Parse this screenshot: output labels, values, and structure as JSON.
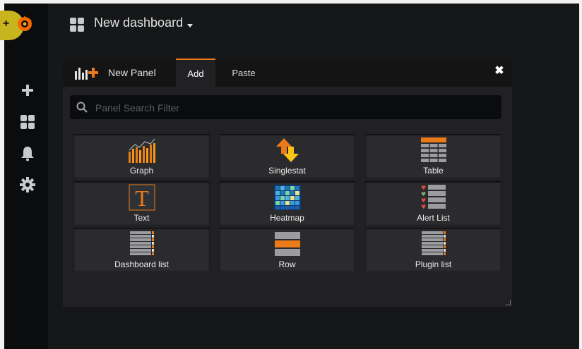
{
  "dashboard": {
    "title": "New dashboard"
  },
  "panel": {
    "title": "New Panel",
    "tabs": [
      "Add",
      "Paste"
    ],
    "close_icon": "close-icon"
  },
  "search": {
    "placeholder": "Panel Search Filter",
    "value": ""
  },
  "panel_types": [
    {
      "label": "Graph",
      "icon": "graph-icon"
    },
    {
      "label": "Singlestat",
      "icon": "singlestat-icon"
    },
    {
      "label": "Table",
      "icon": "table-icon"
    },
    {
      "label": "Text",
      "icon": "text-icon"
    },
    {
      "label": "Heatmap",
      "icon": "heatmap-icon"
    },
    {
      "label": "Alert List",
      "icon": "alert-list-icon"
    },
    {
      "label": "Dashboard list",
      "icon": "dashboard-list-icon"
    },
    {
      "label": "Row",
      "icon": "row-icon"
    },
    {
      "label": "Plugin list",
      "icon": "plugin-list-icon"
    }
  ],
  "sidemenu": [
    "plus-icon",
    "dashboards-icon",
    "bell-icon",
    "gear-icon"
  ],
  "colors": {
    "accent": "#eb7b18",
    "background": "#161719",
    "panel": "#212124"
  }
}
